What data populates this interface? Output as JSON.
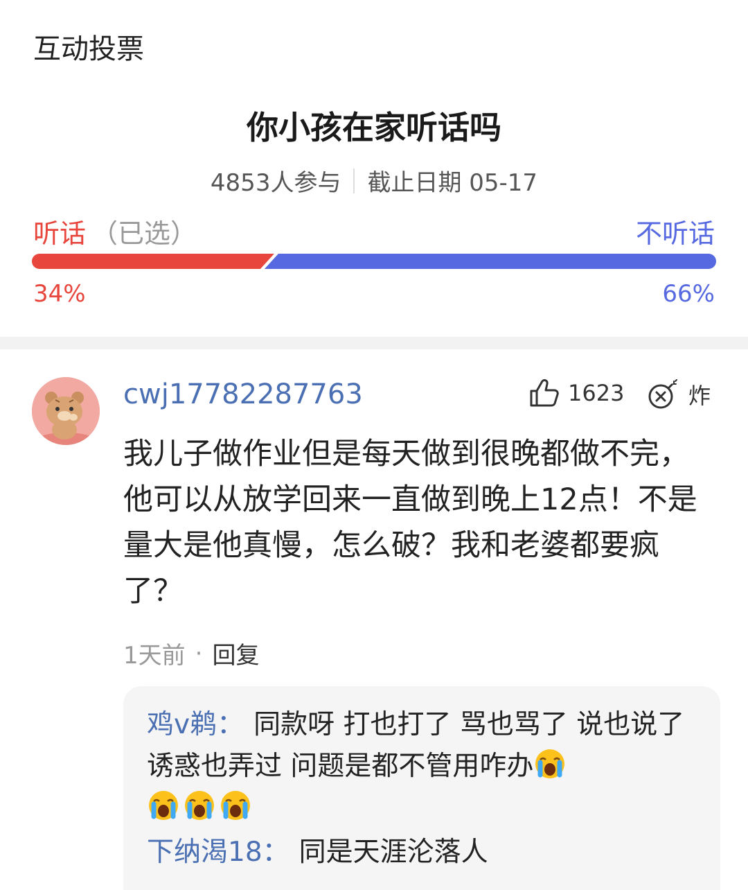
{
  "header": {
    "title": "互动投票"
  },
  "poll": {
    "question": "你小孩在家听话吗",
    "participants": "4853人参与",
    "deadline": "截止日期 05-17",
    "option_left": {
      "label": "听话",
      "selected_tag": "（已选）",
      "percent_text": "34%",
      "share": 0.34,
      "color": "#e8463c"
    },
    "option_right": {
      "label": "不听话",
      "percent_text": "66%",
      "share": 0.66,
      "color": "#5669e0"
    }
  },
  "comment": {
    "username": "cwj17782287763",
    "likes": "1623",
    "bomb_label": "炸",
    "text": "我儿子做作业但是每天做到很晚都做不完，他可以从放学回来一直做到晚上12点！不是量大是他真慢，怎么破？我和老婆都要疯了？",
    "time": "1天前",
    "reply_label": "回复",
    "replies": [
      {
        "name": "鸡v鹈",
        "colon": "：",
        "text": "同款呀  打也打了  骂也骂了  说也说了  诱惑也弄过  问题是都不管用咋办"
      },
      {
        "name": "下纳渴18",
        "colon": "：",
        "text": "同是天涯沦落人"
      }
    ]
  }
}
